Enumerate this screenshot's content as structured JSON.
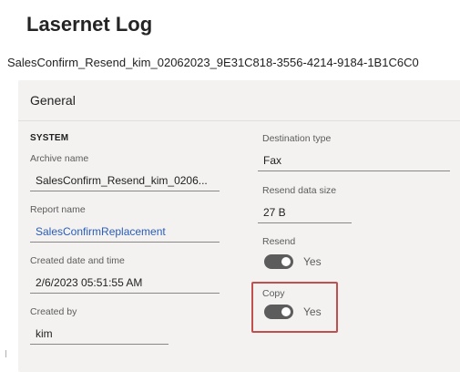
{
  "header": {
    "title": "Lasernet Log",
    "record_id": "SalesConfirm_Resend_kim_02062023_9E31C818-3556-4214-9184-1B1C6C0"
  },
  "card": {
    "title": "General"
  },
  "system": {
    "section_label": "SYSTEM",
    "archive_name_label": "Archive name",
    "archive_name_value": "SalesConfirm_Resend_kim_0206...",
    "report_name_label": "Report name",
    "report_name_value": "SalesConfirmReplacement",
    "created_label": "Created date and time",
    "created_value": "2/6/2023 05:51:55 AM",
    "created_by_label": "Created by",
    "created_by_value": "kim"
  },
  "details": {
    "destination_type_label": "Destination type",
    "destination_type_value": "Fax",
    "resend_size_label": "Resend data size",
    "resend_size_value": "27 B",
    "resend_label": "Resend",
    "resend_value": "Yes",
    "resend_on": true,
    "copy_label": "Copy",
    "copy_value": "Yes",
    "copy_on": true
  },
  "colors": {
    "link": "#2a5cb8",
    "toggle_on": "#5c5c5c",
    "highlight": "#c0504d",
    "card_bg": "#f3f2f1"
  }
}
